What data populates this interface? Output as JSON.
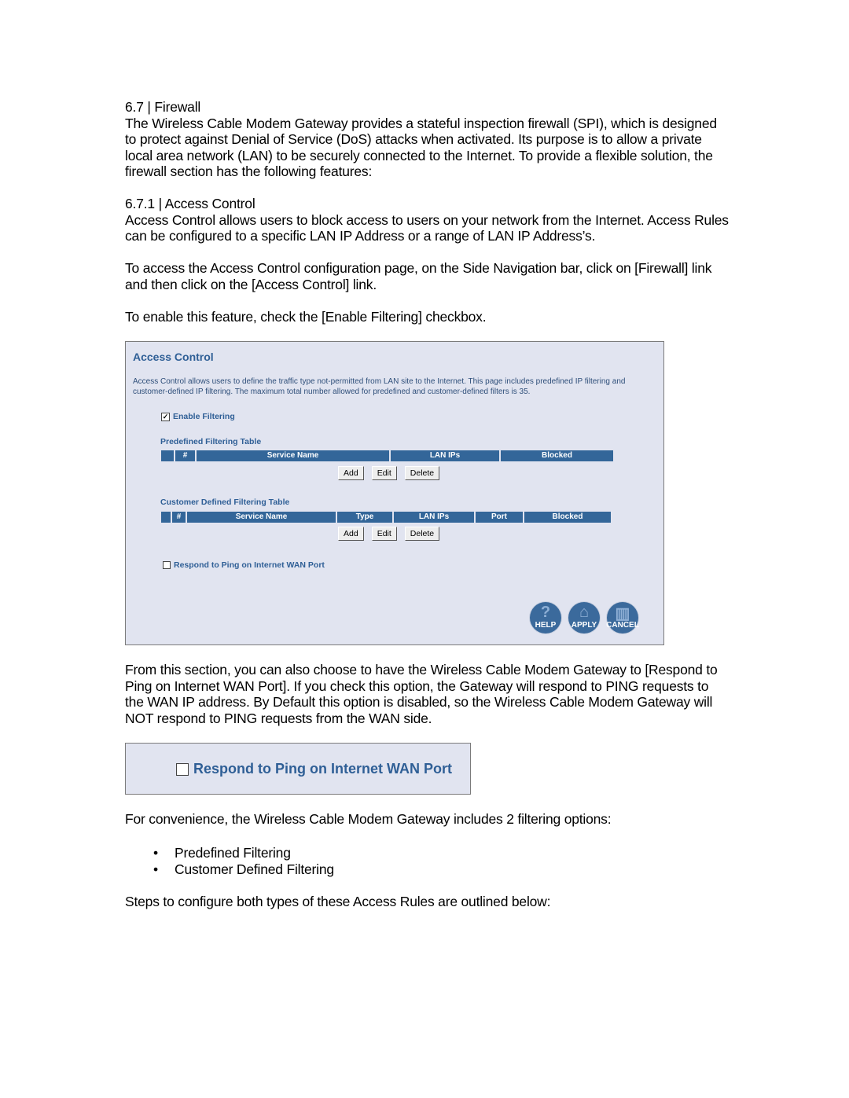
{
  "section": {
    "heading": "6.7 |  Firewall",
    "intro": "The Wireless Cable Modem Gateway provides a stateful inspection firewall (SPI), which is designed to protect against Denial of Service (DoS) attacks when activated. Its purpose is to allow a private local area network (LAN) to be securely connected to the Internet. To provide a flexible solution, the firewall section has the following features:"
  },
  "subsection": {
    "heading": "6.7.1 |  Access Control",
    "para1": "Access Control allows users to block access to users on your network from the Internet. Access Rules can be configured to a specific LAN IP Address or a range of LAN IP Address’s.",
    "para2": "To access the Access Control configuration page, on the Side Navigation bar, click on [Firewall] link and then click on the [Access Control] link.",
    "para3": "To enable this feature, check the [Enable Filtering] checkbox."
  },
  "screenshot": {
    "title": "Access Control",
    "description": "Access Control allows users to define the traffic type not-permitted from LAN site to the Internet. This page includes predefined IP filtering and customer-defined IP filtering. The maximum total number allowed for predefined and customer-defined filters is 35.",
    "enable_filtering": {
      "label": "Enable Filtering",
      "checked": true,
      "mark": "✓"
    },
    "predefined_table": {
      "title": "Predefined Filtering Table",
      "columns": [
        "",
        "#",
        "Service Name",
        "LAN IPs",
        "Blocked"
      ]
    },
    "customer_table": {
      "title": "Customer Defined Filtering Table",
      "columns": [
        "",
        "#",
        "Service Name",
        "Type",
        "LAN IPs",
        "Port",
        "Blocked"
      ]
    },
    "buttons": {
      "add": "Add",
      "edit": "Edit",
      "delete": "Delete"
    },
    "respond_ping": {
      "label": "Respond to Ping on Internet WAN Port",
      "checked": false
    },
    "round_buttons": [
      {
        "label": "HELP",
        "icon": "question-icon",
        "glyph": "?"
      },
      {
        "label": "APPLY",
        "icon": "apply-icon",
        "glyph": "⌂"
      },
      {
        "label": "CANCEL",
        "icon": "trash-icon",
        "glyph": "▥"
      }
    ]
  },
  "ping_section": {
    "para": "From this section, you can also choose to have the Wireless Cable Modem Gateway to [Respond to Ping on Internet WAN Port].  If you check this option, the Gateway will respond to PING requests to the WAN IP address.  By Default this option is disabled, so the Wireless Cable Modem Gateway will NOT respond to PING requests from the WAN side.",
    "snippet_label": "Respond to Ping on Internet WAN Port",
    "snippet_checked": false
  },
  "options": {
    "intro": "For convenience, the Wireless Cable Modem Gateway includes 2 filtering options:",
    "bullet": "•",
    "items": [
      "Predefined Filtering",
      "Customer Defined Filtering"
    ],
    "outro": "Steps to configure both types of these Access Rules are outlined below:"
  }
}
